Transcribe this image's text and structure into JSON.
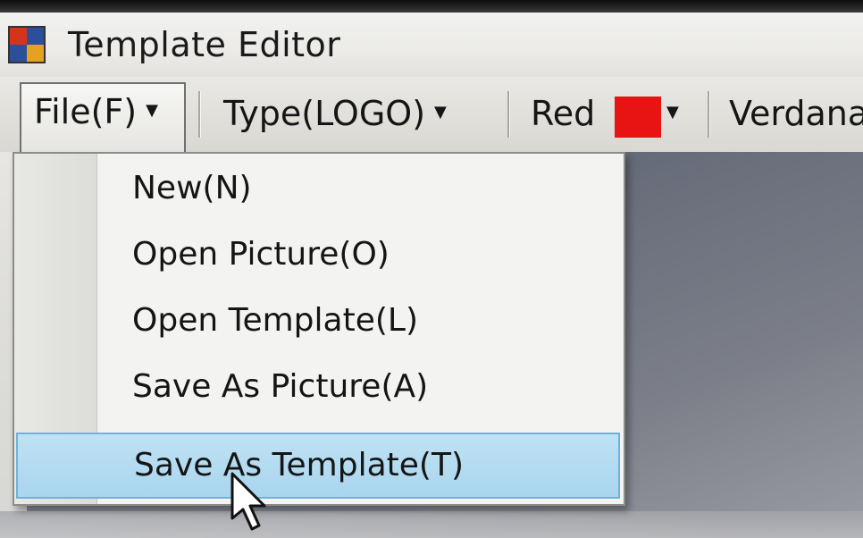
{
  "window": {
    "title": "Template Editor",
    "icon": "app-icon"
  },
  "toolbar": {
    "file": "File(F)",
    "type": "Type(LOGO)",
    "color_label": "Red",
    "color_value": "#e81414",
    "font": "Verdana"
  },
  "file_menu": {
    "items": [
      {
        "label": "New(N)"
      },
      {
        "label": "Open Picture(O)"
      },
      {
        "label": "Open Template(L)"
      },
      {
        "label": "Save As Picture(A)"
      },
      {
        "label": "Save As Template(T)",
        "highlighted": true
      }
    ]
  },
  "colors": {
    "highlight": "#a9d5ee",
    "swatch_red": "#e81414"
  }
}
